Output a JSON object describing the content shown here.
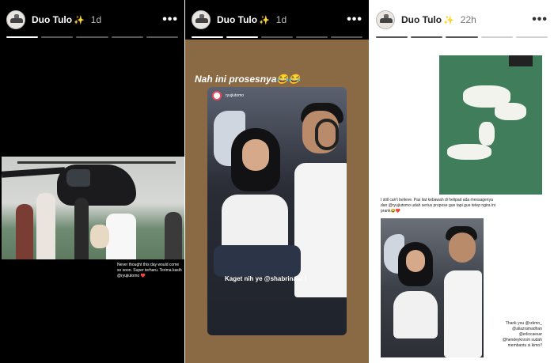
{
  "stories": [
    {
      "username": "Duo Tulo",
      "badge": "✨",
      "time": "1d",
      "caption": "Never thought this day would come so soon. Super terharu. Terima kasih @ryujiutomo",
      "caption_heart": "❤️"
    },
    {
      "username": "Duo Tulo",
      "badge": "✨",
      "time": "1d",
      "title": "Nah ini prosesnya😂😂",
      "repost_handle": "ryujiutomo",
      "sticker_text": "Kaget nih ye @shabrinaar !"
    },
    {
      "username": "Duo Tulo",
      "badge": "✨",
      "time": "22h",
      "text": "I still can't believe. Pas liat kebawah di helipad ada messagenya dan @ryujiutomo udah serius propose gue tapi gue tetep ngira ini prank😂❤️",
      "thanks": "Thank you @rzkmn_ @aliazramadhan @erliccaesar @hendeyknrsm sudah membantu si kimo!!"
    }
  ],
  "icons": {
    "more": "more-options-icon",
    "verified": "sparkle-icon",
    "avatar": "profile-avatar-icon"
  },
  "colors": {
    "panel_bg_dark": "#000000",
    "panel_bg_mid": "#8a6a45",
    "panel_bg_light": "#ffffff",
    "accent_heart": "#e43b4b",
    "sparkle": "#f7c948"
  }
}
